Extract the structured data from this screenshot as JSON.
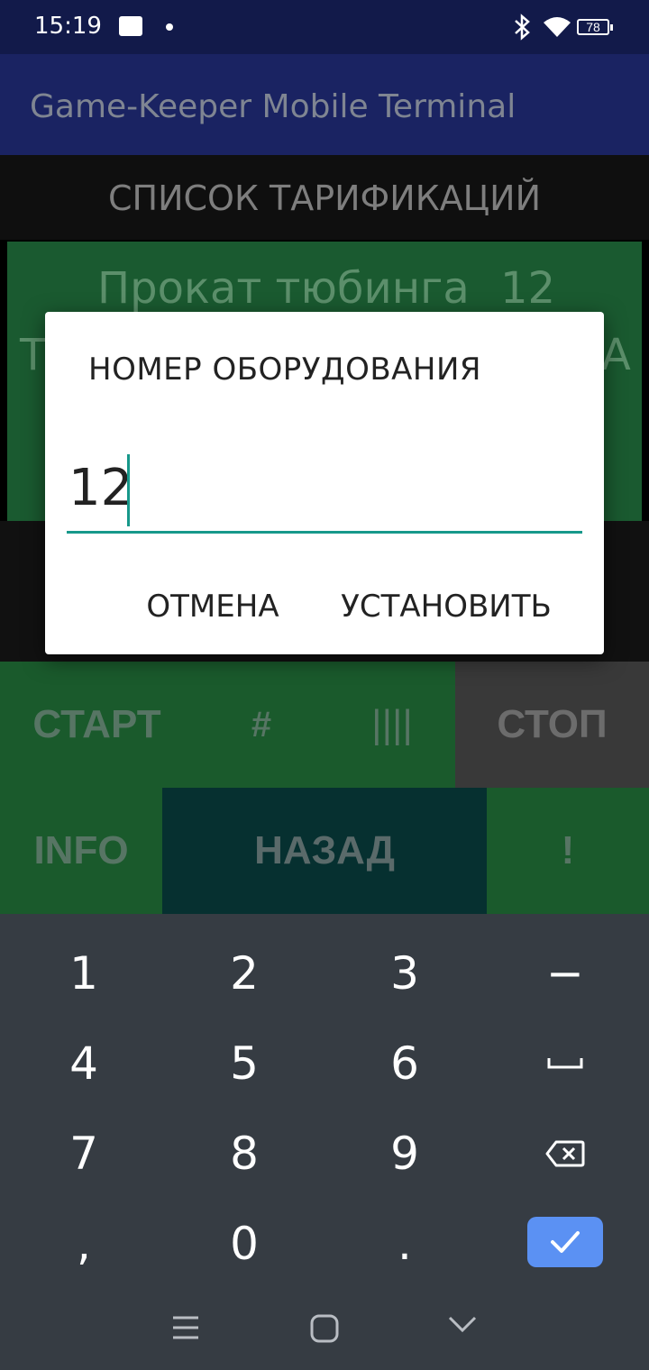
{
  "status": {
    "time": "15:19",
    "battery": "78",
    "icons": [
      "gallery-icon",
      "notification-dot-icon",
      "bluetooth-icon",
      "wifi-icon",
      "battery-icon"
    ]
  },
  "app": {
    "title": "Game-Keeper Mobile Terminal"
  },
  "screen": {
    "header": "СПИСОК ТАРИФИКАЦИЙ",
    "tariff": {
      "name": "Прокат тюбинга",
      "number": "12",
      "left_fragment": "Т",
      "right_fragment": "А"
    },
    "actions": {
      "start": "СТАРТ",
      "hash": "#",
      "bars": "||||",
      "stop": "СТОП",
      "info": "INFO",
      "back": "НАЗАД",
      "alert": "!"
    }
  },
  "dialog": {
    "title": "НОМЕР ОБОРУДОВАНИЯ",
    "input_value": "12",
    "cancel": "ОТМЕНА",
    "confirm": "УСТАНОВИТЬ"
  },
  "keyboard": {
    "keys": [
      "1",
      "2",
      "3",
      "−",
      "4",
      "5",
      "6",
      "␣",
      "7",
      "8",
      "9",
      "⌫",
      ",",
      "0",
      ".",
      "✓"
    ]
  },
  "colors": {
    "status_bar": "#121a4a",
    "app_bar": "#1a2362",
    "green_panel": "#1a5a2c",
    "stop_gray": "#393939",
    "back_teal": "#063030",
    "accent": "#17988a",
    "keyboard_bg": "#363c43",
    "enter_key": "#5b91f3"
  }
}
